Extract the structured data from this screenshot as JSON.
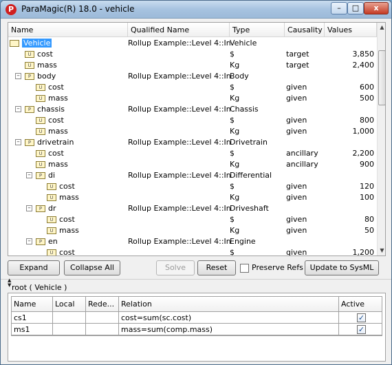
{
  "window": {
    "title": "ParaMagic(R) 18.0 - vehicle",
    "icon_letter": "P"
  },
  "titlebar": {
    "minimize": "–",
    "maximize": "□",
    "close": "x"
  },
  "tree": {
    "columns": [
      "Name",
      "Qualified Name",
      "Type",
      "Causality",
      "Values"
    ],
    "rows": [
      {
        "depth": 0,
        "icon": "",
        "expander": "",
        "name": "Vehicle",
        "qn": "Rollup Example::Level 4::In...",
        "type": "Vehicle",
        "causality": "",
        "value": "",
        "selected": true
      },
      {
        "depth": 1,
        "icon": "U",
        "expander": "",
        "name": "cost",
        "qn": "",
        "type": "$",
        "causality": "target",
        "value": "3,850"
      },
      {
        "depth": 1,
        "icon": "U",
        "expander": "",
        "name": "mass",
        "qn": "",
        "type": "Kg",
        "causality": "target",
        "value": "2,400"
      },
      {
        "depth": 1,
        "icon": "P",
        "expander": "–",
        "name": "body",
        "qn": "Rollup Example::Level 4::In...",
        "type": "Body",
        "causality": "",
        "value": ""
      },
      {
        "depth": 2,
        "icon": "U",
        "expander": "",
        "name": "cost",
        "qn": "",
        "type": "$",
        "causality": "given",
        "value": "600"
      },
      {
        "depth": 2,
        "icon": "U",
        "expander": "",
        "name": "mass",
        "qn": "",
        "type": "Kg",
        "causality": "given",
        "value": "500"
      },
      {
        "depth": 1,
        "icon": "P",
        "expander": "–",
        "name": "chassis",
        "qn": "Rollup Example::Level 4::In...",
        "type": "Chassis",
        "causality": "",
        "value": ""
      },
      {
        "depth": 2,
        "icon": "U",
        "expander": "",
        "name": "cost",
        "qn": "",
        "type": "$",
        "causality": "given",
        "value": "800"
      },
      {
        "depth": 2,
        "icon": "U",
        "expander": "",
        "name": "mass",
        "qn": "",
        "type": "Kg",
        "causality": "given",
        "value": "1,000"
      },
      {
        "depth": 1,
        "icon": "P",
        "expander": "–",
        "name": "drivetrain",
        "qn": "Rollup Example::Level 4::In...",
        "type": "Drivetrain",
        "causality": "",
        "value": ""
      },
      {
        "depth": 2,
        "icon": "U",
        "expander": "",
        "name": "cost",
        "qn": "",
        "type": "$",
        "causality": "ancillary",
        "value": "2,200"
      },
      {
        "depth": 2,
        "icon": "U",
        "expander": "",
        "name": "mass",
        "qn": "",
        "type": "Kg",
        "causality": "ancillary",
        "value": "900"
      },
      {
        "depth": 2,
        "icon": "P",
        "expander": "–",
        "name": "di",
        "qn": "Rollup Example::Level 4::In...",
        "type": "Differential",
        "causality": "",
        "value": ""
      },
      {
        "depth": 3,
        "icon": "U",
        "expander": "",
        "name": "cost",
        "qn": "",
        "type": "$",
        "causality": "given",
        "value": "120"
      },
      {
        "depth": 3,
        "icon": "U",
        "expander": "",
        "name": "mass",
        "qn": "",
        "type": "Kg",
        "causality": "given",
        "value": "100"
      },
      {
        "depth": 2,
        "icon": "P",
        "expander": "–",
        "name": "dr",
        "qn": "Rollup Example::Level 4::In...",
        "type": "Driveshaft",
        "causality": "",
        "value": ""
      },
      {
        "depth": 3,
        "icon": "U",
        "expander": "",
        "name": "cost",
        "qn": "",
        "type": "$",
        "causality": "given",
        "value": "80"
      },
      {
        "depth": 3,
        "icon": "U",
        "expander": "",
        "name": "mass",
        "qn": "",
        "type": "Kg",
        "causality": "given",
        "value": "50"
      },
      {
        "depth": 2,
        "icon": "P",
        "expander": "–",
        "name": "en",
        "qn": "Rollup Example::Level 4::In...",
        "type": "Engine",
        "causality": "",
        "value": ""
      },
      {
        "depth": 3,
        "icon": "U",
        "expander": "",
        "name": "cost",
        "qn": "",
        "type": "$",
        "causality": "given",
        "value": "1,200"
      }
    ]
  },
  "buttons": {
    "expand": "Expand",
    "collapse_all": "Collapse All",
    "solve": "Solve",
    "reset": "Reset",
    "preserve_refs": "Preserve Refs",
    "update": "Update to SysML"
  },
  "lower": {
    "label": "root ( Vehicle )",
    "columns": [
      "Name",
      "Local",
      "Rede...",
      "Relation",
      "Active"
    ],
    "rows": [
      {
        "name": "cs1",
        "local": "",
        "rede": "",
        "relation": "cost=sum(sc.cost)",
        "active": "✓"
      },
      {
        "name": "ms1",
        "local": "",
        "rede": "",
        "relation": "mass=sum(comp.mass)",
        "active": "✓"
      }
    ]
  }
}
